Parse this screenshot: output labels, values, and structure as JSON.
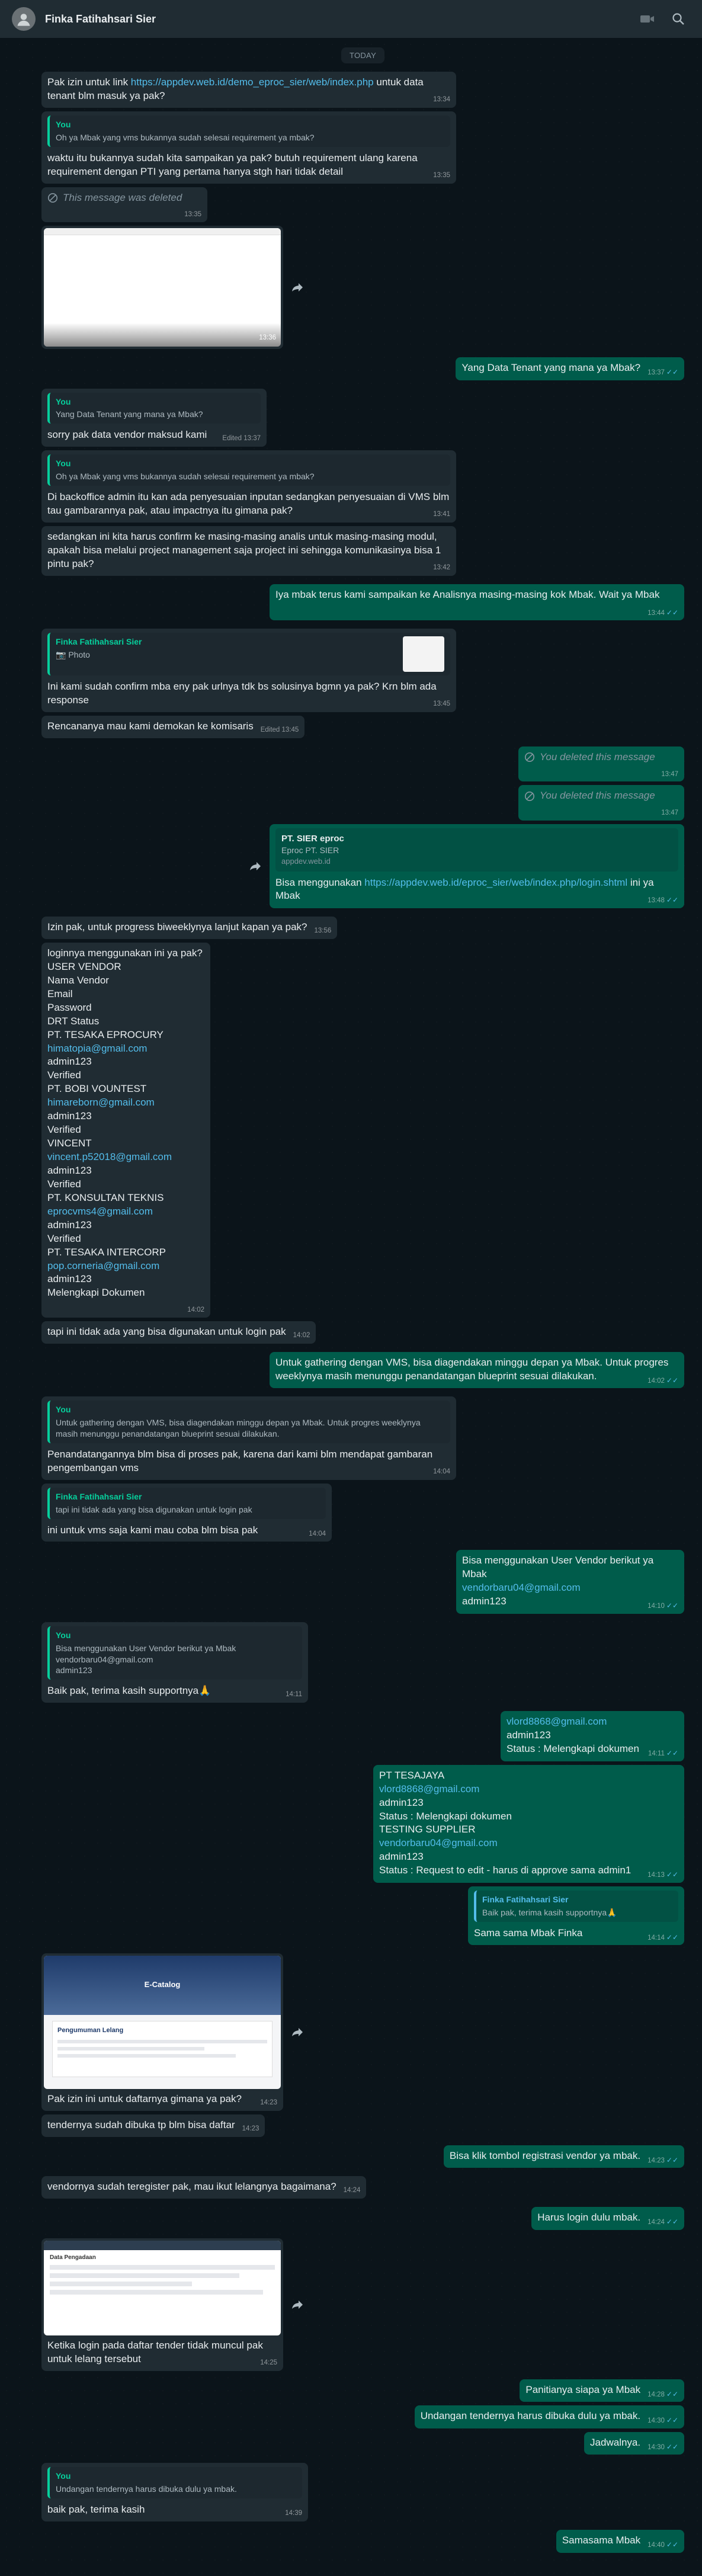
{
  "header": {
    "title": "Finka Fatihahsari Sier"
  },
  "day_label": "TODAY",
  "m1": {
    "pre": "Pak izin untuk link ",
    "link": "https://appdev.web.id/demo_eproc_sier/web/index.php",
    "post": " untuk data tenant blm masuk ya pak?",
    "time": "13:34"
  },
  "m2": {
    "quote_author": "You",
    "quote_text": "Oh ya Mbak yang vms bukannya sudah selesai requirement ya mbak?",
    "text": "waktu itu bukannya sudah kita sampaikan ya pak? butuh requirement ulang karena requirement dengan PTI yang pertama hanya stgh hari tidak detail",
    "time": "13:35"
  },
  "m3": {
    "text": "This message was deleted",
    "time": "13:35"
  },
  "m4": {
    "time": "13:36"
  },
  "m5": {
    "text": "Yang Data Tenant yang mana ya Mbak?",
    "time": "13:37"
  },
  "m6": {
    "quote_author": "You",
    "quote_text": "Yang Data Tenant yang mana ya Mbak?",
    "text": "sorry pak data vendor maksud kami",
    "edited": "Edited",
    "time": "13:37"
  },
  "m7": {
    "quote_author": "You",
    "quote_text": "Oh ya Mbak yang vms bukannya sudah selesai requirement ya mbak?",
    "text": "Di backoffice admin itu kan ada penyesuaian inputan sedangkan penyesuaian di VMS blm tau gambarannya pak, atau impactnya itu gimana pak?",
    "time": "13:41"
  },
  "m8": {
    "text": "sedangkan ini kita harus confirm ke masing-masing analis untuk masing-masing modul, apakah bisa melalui project management saja project ini sehingga komunikasinya bisa 1 pintu pak?",
    "time": "13:42"
  },
  "m9": {
    "text": "Iya mbak terus kami sampaikan ke Analisnya masing-masing kok Mbak. Wait ya Mbak",
    "time": "13:44"
  },
  "m10": {
    "quote_author": "Finka Fatihahsari Sier",
    "quote_text": "Photo",
    "text": "Ini kami sudah confirm mba eny pak urlnya tdk bs solusinya bgmn ya pak? Krn blm ada response",
    "time": "13:45"
  },
  "m11": {
    "text": "Rencananya mau kami demokan ke komisaris",
    "edited": "Edited",
    "time": "13:45"
  },
  "m12": {
    "text": "You deleted this message",
    "time": "13:47"
  },
  "m13": {
    "text": "You deleted this message",
    "time": "13:47"
  },
  "m14": {
    "preview_title": "PT. SIER eproc",
    "preview_desc": "Eproc PT. SIER",
    "preview_url": "appdev.web.id",
    "pre": "Bisa menggunakan ",
    "link": "https://appdev.web.id/eproc_sier/web/index.php/login.shtml",
    "post": " ini ya Mbak",
    "time": "13:48"
  },
  "m15": {
    "text": "Izin pak, untuk progress biweeklynya lanjut kapan ya pak?",
    "time": "13:56"
  },
  "m16": {
    "lines": [
      {
        "t": "loginnya menggunakan ini ya pak?",
        "link": false
      },
      {
        "t": "USER VENDOR",
        "link": false
      },
      {
        "t": "Nama Vendor",
        "link": false
      },
      {
        "t": "Email",
        "link": false
      },
      {
        "t": "Password",
        "link": false
      },
      {
        "t": "DRT Status",
        "link": false
      },
      {
        "t": "PT. TESAKA EPROCURY",
        "link": false
      },
      {
        "t": "himatopia@gmail.com",
        "link": true
      },
      {
        "t": "admin123",
        "link": false
      },
      {
        "t": "Verified",
        "link": false
      },
      {
        "t": "PT. BOBI VOUNTEST",
        "link": false
      },
      {
        "t": "himareborn@gmail.com",
        "link": true
      },
      {
        "t": "admin123",
        "link": false
      },
      {
        "t": "Verified",
        "link": false
      },
      {
        "t": "VINCENT",
        "link": false
      },
      {
        "t": "vincent.p52018@gmail.com",
        "link": true
      },
      {
        "t": "admin123",
        "link": false
      },
      {
        "t": "Verified",
        "link": false
      },
      {
        "t": "PT. KONSULTAN TEKNIS",
        "link": false
      },
      {
        "t": "eprocvms4@gmail.com",
        "link": true
      },
      {
        "t": "admin123",
        "link": false
      },
      {
        "t": "Verified",
        "link": false
      },
      {
        "t": "PT. TESAKA INTERCORP",
        "link": false
      },
      {
        "t": "pop.corneria@gmail.com",
        "link": true
      },
      {
        "t": "admin123",
        "link": false
      },
      {
        "t": "Melengkapi Dokumen",
        "link": false
      }
    ],
    "time": "14:02"
  },
  "m17": {
    "text": "tapi ini tidak ada yang bisa digunakan untuk login pak",
    "time": "14:02"
  },
  "m18": {
    "text": "Untuk gathering dengan VMS, bisa diagendakan minggu depan ya Mbak. Untuk progres weeklynya masih menunggu penandatangan blueprint sesuai dilakukan.",
    "time": "14:02"
  },
  "m19": {
    "quote_author": "You",
    "quote_text": "Untuk gathering dengan VMS, bisa diagendakan minggu depan ya Mbak. Untuk progres weeklynya masih menunggu penandatangan blueprint sesuai dilakukan.",
    "text": "Penandatangannya blm bisa di proses pak, karena dari kami blm mendapat gambaran pengembangan vms",
    "time": "14:04"
  },
  "m20": {
    "quote_author": "Finka Fatihahsari Sier",
    "quote_text": "tapi ini tidak ada yang bisa digunakan untuk login pak",
    "text": "ini untuk vms saja kami mau coba blm bisa pak",
    "time": "14:04"
  },
  "m21": {
    "line1": "Bisa menggunakan User Vendor berikut ya Mbak",
    "email": "vendorbaru04@gmail.com",
    "pass": "admin123",
    "time": "14:10"
  },
  "m22": {
    "quote_author": "You",
    "quote_lines": [
      "Bisa menggunakan User Vendor berikut ya Mbak",
      "vendorbaru04@gmail.com",
      "admin123"
    ],
    "text": "Baik pak, terima kasih supportnya🙏",
    "time": "14:11"
  },
  "m23": {
    "email": "vlord8868@gmail.com",
    "pass": "admin123",
    "status": "Status : Melengkapi dokumen",
    "time": "14:11"
  },
  "m24": {
    "lines": [
      "PT TESAJAYA",
      "vlord8868@gmail.com",
      "admin123",
      "Status : Melengkapi dokumen",
      "TESTING SUPPLIER",
      "vendorbaru04@gmail.com",
      "admin123",
      "Status : Request to edit - harus di approve sama admin1"
    ],
    "time": "14:13"
  },
  "m25": {
    "quote_author": "Finka Fatihahsari Sier",
    "quote_text": "Baik pak, terima kasih supportnya🙏",
    "text": "Sama sama Mbak Finka",
    "time": "14:14"
  },
  "m26": {
    "thumb_title": "E-Catalog",
    "thumb_sub": "Pengumuman Lelang",
    "text": "Pak izin ini untuk daftarnya gimana ya pak?",
    "time": "14:23"
  },
  "m27": {
    "text": "tendernya sudah dibuka tp blm bisa daftar",
    "time": "14:23"
  },
  "m28": {
    "text": "Bisa klik tombol registrasi vendor ya mbak.",
    "time": "14:23"
  },
  "m29": {
    "text": "vendornya sudah teregister pak, mau ikut lelangnya bagaimana?",
    "time": "14:24"
  },
  "m30": {
    "text": "Harus login dulu mbak.",
    "time": "14:24"
  },
  "m31": {
    "thumb_title": "Data Pengadaan",
    "text": "Ketika login pada daftar tender tidak muncul pak untuk lelang tersebut",
    "time": "14:25"
  },
  "m32": {
    "text": "Panitianya siapa ya Mbak",
    "time": "14:28"
  },
  "m33": {
    "text": "Undangan tendernya harus dibuka dulu ya mbak.",
    "time": "14:30"
  },
  "m34": {
    "text": "Jadwalnya.",
    "time": "14:30"
  },
  "m35": {
    "quote_author": "You",
    "quote_text": "Undangan tendernya harus dibuka dulu ya mbak.",
    "text": "baik pak, terima kasih",
    "time": "14:39"
  },
  "m36": {
    "text": "Samasama Mbak",
    "time": "14:40"
  },
  "colors": {
    "incoming": "#202c33",
    "outgoing": "#005c4b",
    "link": "#53bdeb",
    "accent": "#06cf9c",
    "background": "#0b141a"
  }
}
